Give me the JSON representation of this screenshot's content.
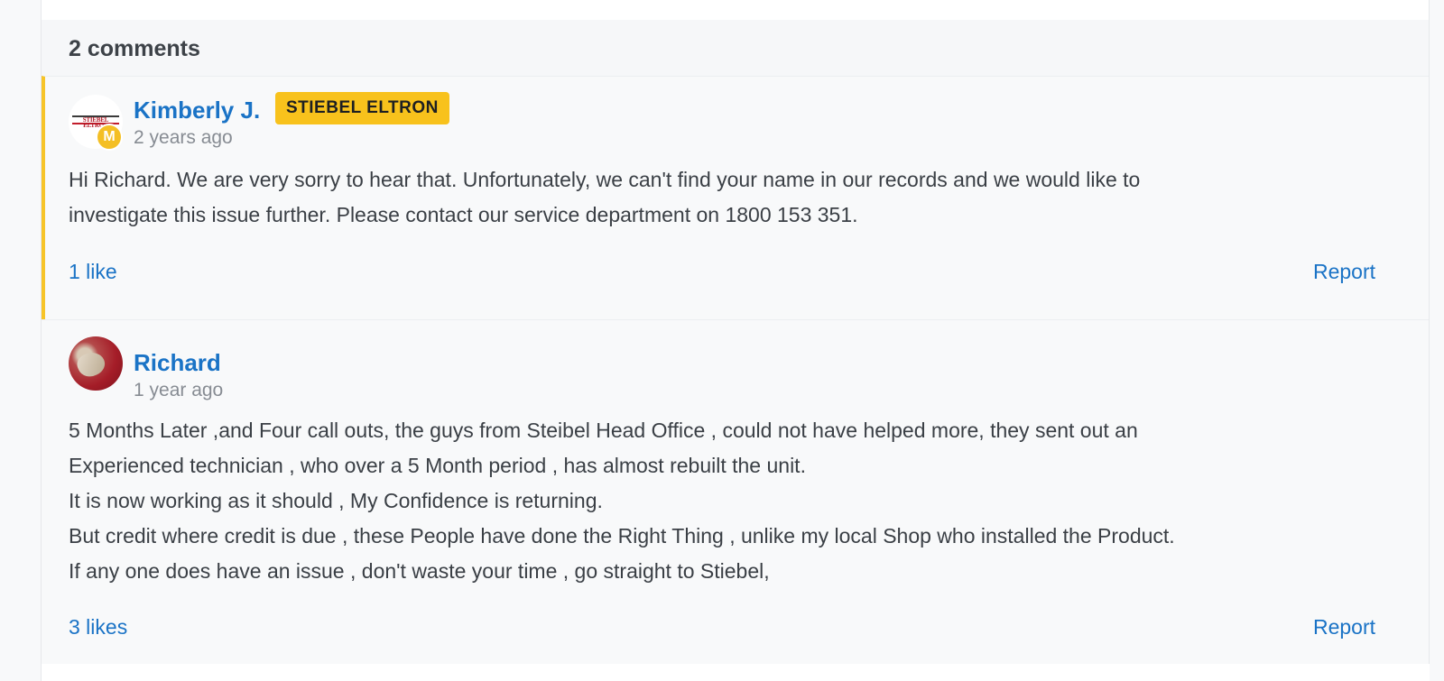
{
  "comments_section": {
    "header": "2 comments",
    "comments": [
      {
        "author": "Kimberly J.",
        "avatar_icon": "stiebel-eltron-logo",
        "avatar_logo_text": "STIEBEL ELTRON",
        "moderator_badge": "M",
        "badge": "STIEBEL ELTRON",
        "badge_color": "#f8c21c",
        "timestamp": "2 years ago",
        "body": [
          "Hi Richard. We are very sorry to hear that. Unfortunately, we can't find your name in our records and we would like to",
          "investigate this issue further. Please contact our service department on 1800 153 351."
        ],
        "likes": "1 like",
        "report": "Report"
      },
      {
        "author": "Richard",
        "avatar_icon": "user-photo",
        "timestamp": "1 year ago",
        "body": [
          "5 Months Later ,and Four call outs, the guys from Steibel Head Office , could not have helped more, they sent out an",
          "Experienced technician , who over a 5 Month period , has almost rebuilt the unit.",
          "It is now working as it should , My Confidence is returning.",
          "But credit where credit is due , these People have done the Right Thing , unlike my local Shop who installed the Product.",
          "If any one does have an issue , don't waste your time , go straight to Stiebel,"
        ],
        "likes": "3 likes",
        "report": "Report"
      }
    ]
  },
  "colors": {
    "link": "#1a73c6",
    "accent_border": "#f7c428",
    "moderator": "#f4bf25"
  }
}
